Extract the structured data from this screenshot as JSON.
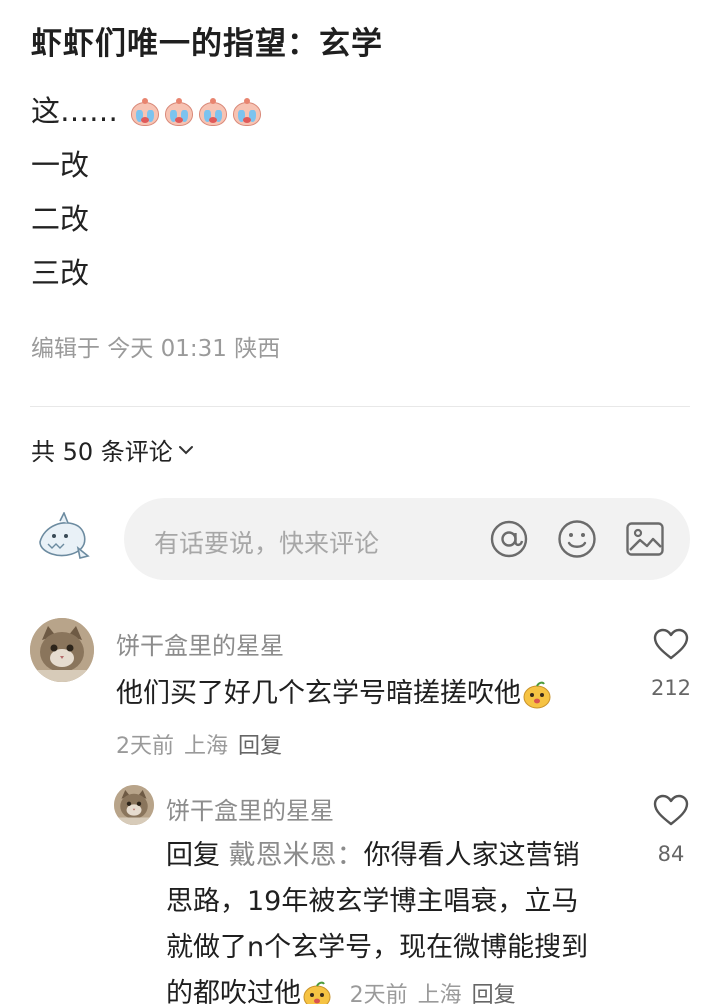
{
  "post": {
    "title": "虾虾们唯一的指望：玄学",
    "lines": [
      "这……",
      "一改",
      "二改",
      "三改"
    ],
    "emoji_name": "crying-face-emoji",
    "meta": "编辑于 今天 01:31 陕西"
  },
  "comments_header": {
    "count_label": "共 50 条评论"
  },
  "composer": {
    "placeholder": "有话要说，快来评论",
    "icons": [
      "at-icon",
      "smiley-icon",
      "image-icon"
    ]
  },
  "comments": [
    {
      "user": "饼干盒里的星星",
      "text": "他们买了好几个玄学号暗搓搓吹他",
      "time": "2天前",
      "location": "上海",
      "reply_label": "回复",
      "likes": "212",
      "replies": [
        {
          "user": "饼干盒里的星星",
          "prefix": "回复",
          "mention": "戴恩米恩：",
          "text_lines": [
            "你得看人家这营销",
            "思路，19年被玄学博主唱衰，立马",
            "就做了n个玄学号，现在微博能搜到",
            "的都吹过他"
          ],
          "time": "2天前",
          "location": "上海",
          "reply_label": "回复",
          "likes": "84"
        }
      ]
    }
  ]
}
